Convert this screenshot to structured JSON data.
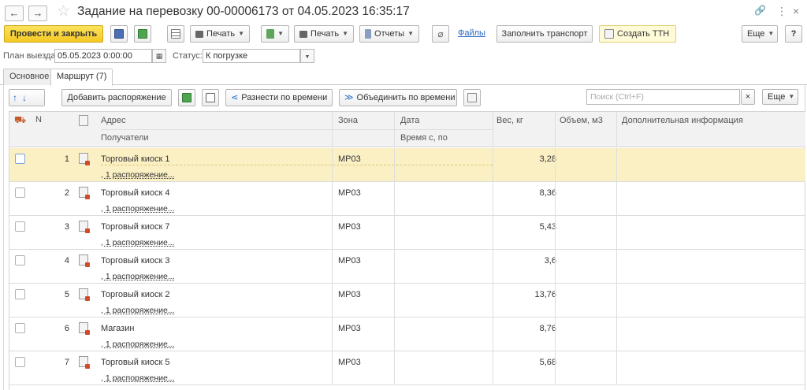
{
  "window": {
    "title": "Задание на перевозку 00-00006173 от 04.05.2023 16:35:17",
    "back_glyph": "←",
    "forward_glyph": "→",
    "star_glyph": "☆",
    "link_glyph": "🔗",
    "menu_glyph": "⋮",
    "close_glyph": "×"
  },
  "toolbar": {
    "post_close": "Провести и закрыть",
    "print1": "Печать",
    "print2": "Печать",
    "reports": "Отчеты",
    "files": "Файлы",
    "fill_transport": "Заполнить транспорт",
    "create_ttn": "Создать ТТН",
    "more": "Еще",
    "help": "?"
  },
  "fields": {
    "plan_label": "План выезда:",
    "plan_value": "05.05.2023  0:00:00",
    "status_label": "Статус:",
    "status_value": "К погрузке"
  },
  "tabs": [
    {
      "label": "Основное"
    },
    {
      "label": "Маршрут (7)"
    }
  ],
  "route_toolbar": {
    "add_order": "Добавить распоряжение",
    "distribute_time": "Разнести по времени",
    "merge_time": "Объединить по времени",
    "search_placeholder": "Поиск (Ctrl+F)",
    "search_clear": "×",
    "more": "Еще"
  },
  "table": {
    "headers": {
      "n": "N",
      "address": "Адрес",
      "recipients": "Получатели",
      "zone": "Зона",
      "date": "Дата",
      "time": "Время с, по",
      "weight": "Вес, кг",
      "volume": "Объем, м3",
      "info": "Дополнительная информация"
    },
    "rows": [
      {
        "n": "1",
        "address": "Торговый киоск 1",
        "orders": ", 1 распоряжение...",
        "zone": "МР03",
        "weight": "3,28"
      },
      {
        "n": "2",
        "address": "Торговый киоск 4",
        "orders": ", 1 распоряжение...",
        "zone": "МР03",
        "weight": "8,36"
      },
      {
        "n": "3",
        "address": "Торговый киоск 7",
        "orders": ", 1 распоряжение...",
        "zone": "МР03",
        "weight": "5,43"
      },
      {
        "n": "4",
        "address": "Торговый киоск 3",
        "orders": ", 1 распоряжение...",
        "zone": "МР03",
        "weight": "3,6"
      },
      {
        "n": "5",
        "address": "Торговый киоск 2",
        "orders": ", 1 распоряжение...",
        "zone": "МР03",
        "weight": "13,76"
      },
      {
        "n": "6",
        "address": "Магазин",
        "orders": ", 1 распоряжение...",
        "zone": "МР03",
        "weight": "8,76"
      },
      {
        "n": "7",
        "address": "Торговый киоск 5",
        "orders": ", 1 распоряжение...",
        "zone": "МР03",
        "weight": "5,68"
      }
    ]
  },
  "colors": {
    "primary_button": "#f5c924",
    "selected_row": "#fbf0c4",
    "link": "#2a6ac2"
  }
}
